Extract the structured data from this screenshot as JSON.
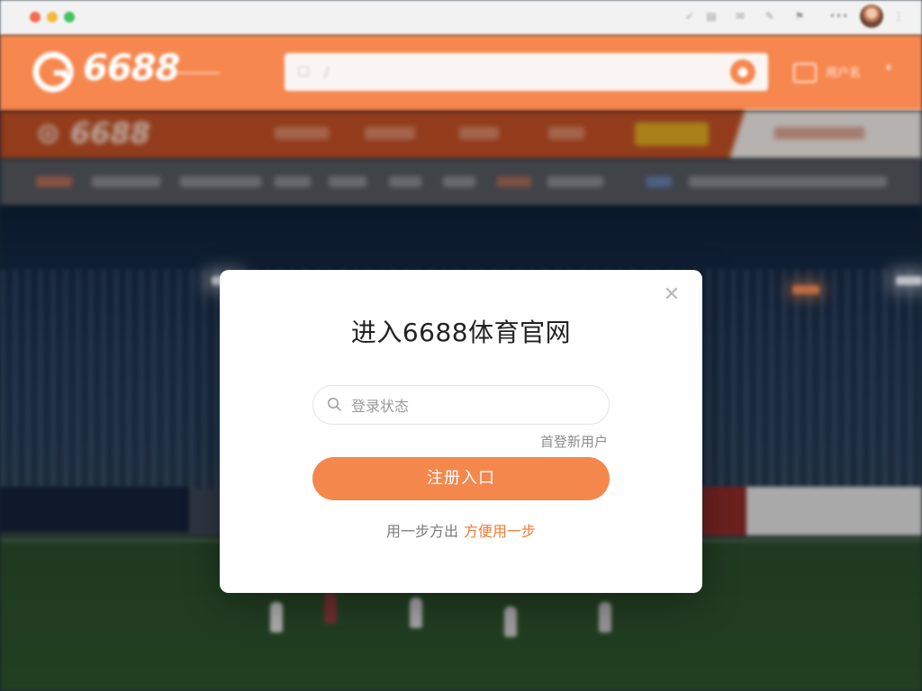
{
  "header": {
    "logo_text": "6688",
    "search_placeholder": "",
    "user_label": "用户名"
  },
  "modal": {
    "title": "进入6688体育官网",
    "input_placeholder": "登录状态",
    "new_user_link": "首登新用户",
    "register_button": "注册入口",
    "bottom_text": "用一步方出",
    "bottom_link": "方便用一步",
    "close_icon": "close-icon"
  },
  "colors": {
    "brand_orange": "#f6874f",
    "button_orange": "#f4874c",
    "link_orange": "#ef7a31"
  }
}
